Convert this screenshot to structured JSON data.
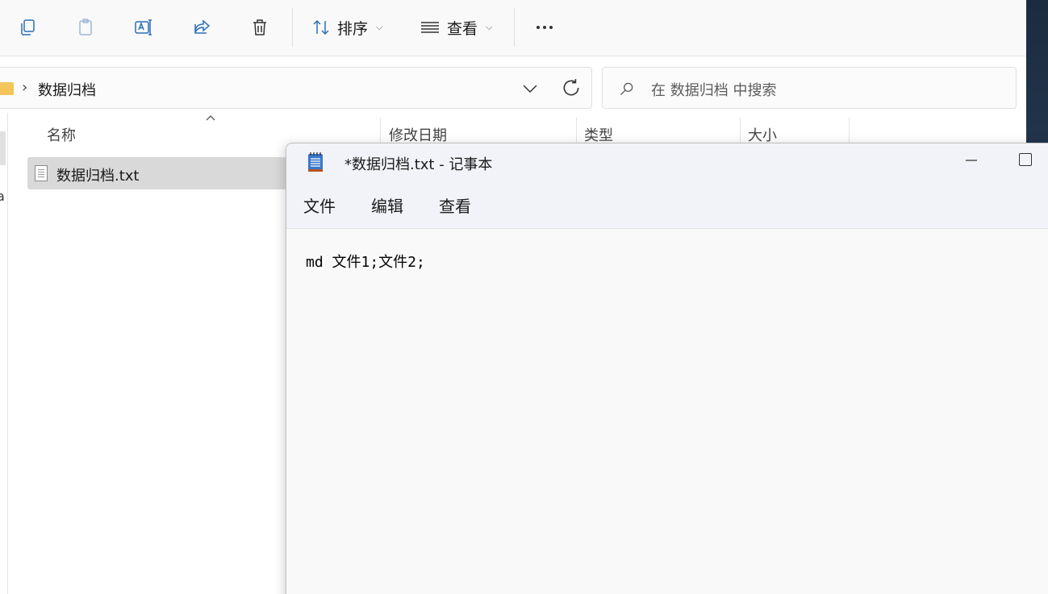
{
  "explorer": {
    "toolbar": {
      "copy_icon": "copy-icon",
      "paste_icon": "paste-icon",
      "rename_icon": "rename-icon",
      "share_icon": "share-icon",
      "delete_icon": "delete-icon",
      "sort_label": "排序",
      "view_label": "查看",
      "more_icon": "more-icon"
    },
    "address": {
      "current_folder": "数据归档",
      "separator": "›"
    },
    "search": {
      "placeholder": "在 数据归档 中搜索"
    },
    "nav_partial_text": "a",
    "columns": [
      "名称",
      "修改日期",
      "类型",
      "大小"
    ],
    "files": [
      {
        "name": "数据归档.txt",
        "selected": true
      }
    ]
  },
  "notepad": {
    "title": "*数据归档.txt - 记事本",
    "menu": [
      "文件",
      "编辑",
      "查看"
    ],
    "content": "md 文件1;文件2;"
  },
  "colors": {
    "toolbar_bg": "#f9f9f9",
    "selection_bg": "#d9d9d9",
    "folder_yellow": "#f3c55b",
    "notepad_titlebar": "#f1f3f8",
    "accent_icon": "#2a6fb8"
  }
}
